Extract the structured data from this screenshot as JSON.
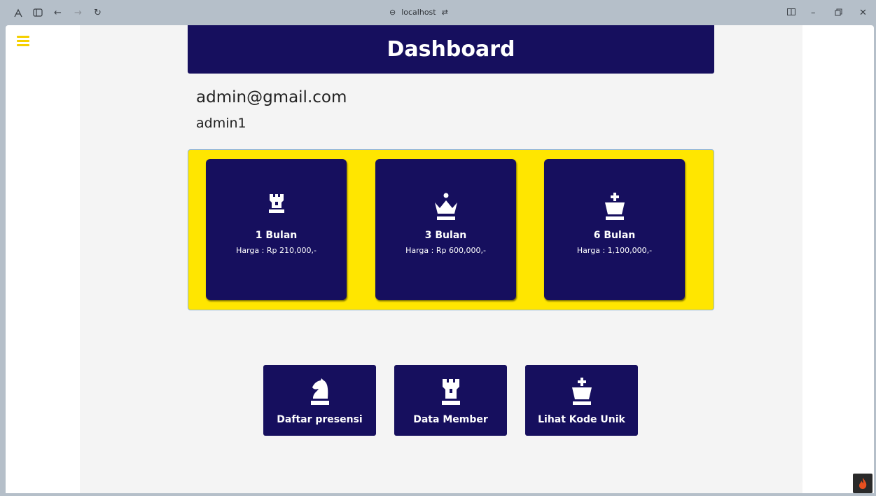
{
  "browser": {
    "url": "localhost"
  },
  "page": {
    "title": "Dashboard",
    "email": "admin@gmail.com",
    "username": "admin1"
  },
  "plans": [
    {
      "name": "1 Bulan",
      "price": "Harga : Rp 210,000,-",
      "icon": "chess-rook-icon"
    },
    {
      "name": "3 Bulan",
      "price": "Harga : Rp 600,000,-",
      "icon": "chess-queen-icon"
    },
    {
      "name": "6 Bulan",
      "price": "Harga : 1,100,000,-",
      "icon": "chess-king-icon"
    }
  ],
  "actions": [
    {
      "label": "Daftar presensi",
      "icon": "chess-knight-icon"
    },
    {
      "label": "Data Member",
      "icon": "chess-rook-icon"
    },
    {
      "label": "Lihat Kode Unik",
      "icon": "chess-king-icon"
    }
  ],
  "colors": {
    "primary": "#160f5e",
    "accent": "#ffe600",
    "background": "#f4f4f4"
  }
}
